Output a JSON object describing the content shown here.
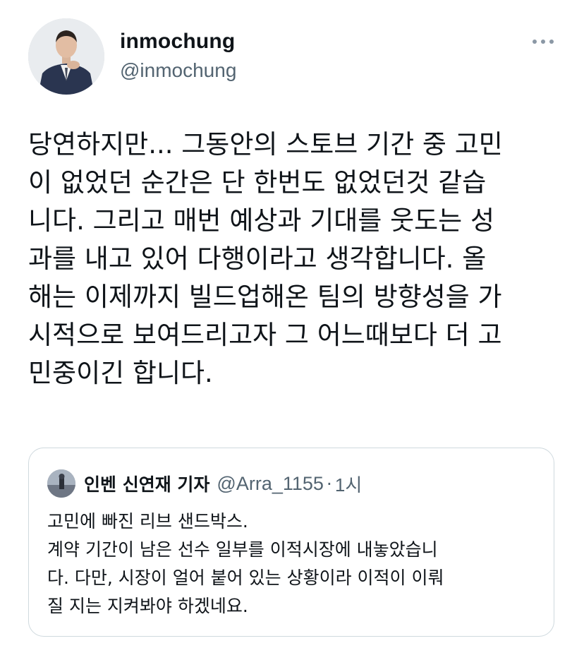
{
  "author": {
    "name": "inmochung",
    "handle": "@inmochung"
  },
  "tweet": {
    "text": "당연하지만... 그동안의 스토브 기간 중 고민\n이 없었던 순간은 단 한번도 없었던것 같습\n니다. 그리고 매번 예상과 기대를 웃도는 성\n과를 내고 있어 다행이라고 생각합니다. 올\n해는 이제까지 빌드업해온 팀의 방향성을 가\n시적으로 보여드리고자 그 어느때보다 더 고\n민중이긴 합니다."
  },
  "quote": {
    "name": "인벤 신연재 기자",
    "handle": "@Arra_1155",
    "separator": "·",
    "time": "1시",
    "text": "고민에 빠진 리브 샌드박스.\n계약 기간이 남은 선수 일부를 이적시장에 내놓았습니\n다. 다만, 시장이 얼어 붙어 있는 상황이라 이적이 이뤄\n질 지는 지켜봐야 하겠네요."
  },
  "icons": {
    "more": "more-horizontal-icon",
    "avatar": "avatar-photo",
    "quote_avatar": "avatar-photo"
  },
  "colors": {
    "text_primary": "#0f1419",
    "text_secondary": "#536471",
    "border": "#cfd9de",
    "background": "#ffffff"
  }
}
